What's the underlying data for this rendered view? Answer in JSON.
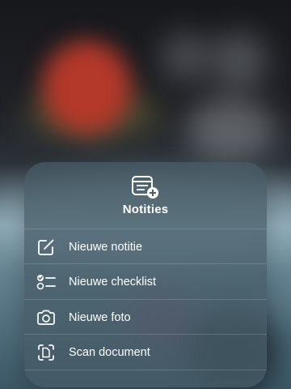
{
  "menu": {
    "title": "Notities",
    "app_icon": "notes-add-icon",
    "actions": [
      {
        "label": "Nieuwe notitie",
        "icon": "compose-icon"
      },
      {
        "label": "Nieuwe checklist",
        "icon": "checklist-icon"
      },
      {
        "label": "Nieuwe foto",
        "icon": "camera-icon"
      },
      {
        "label": "Scan document",
        "icon": "scan-document-icon"
      }
    ]
  },
  "colors": {
    "menu_background": "#465c66",
    "text": "#ffffff"
  }
}
